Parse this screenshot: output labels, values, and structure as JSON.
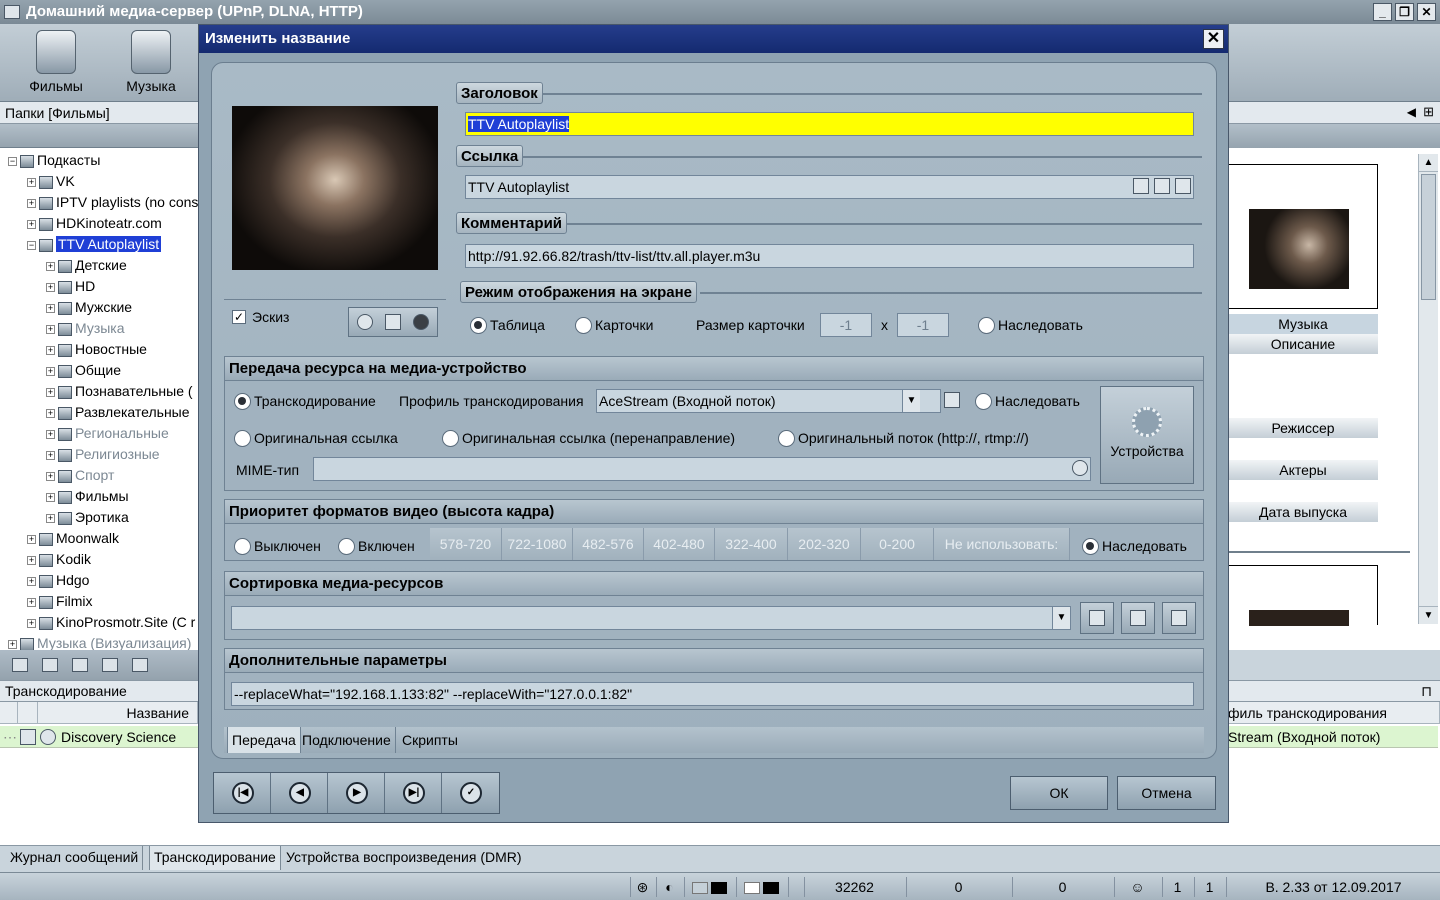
{
  "window": {
    "title": "Домашний медиа-сервер (UPnP, DLNA, HTTP)"
  },
  "toolbar": {
    "films": "Фильмы",
    "music": "Музыка"
  },
  "left": {
    "header": "Папки [Фильмы]",
    "tree": [
      {
        "label": "Подкасты",
        "level": 0
      },
      {
        "label": "VK",
        "level": 1
      },
      {
        "label": "IPTV playlists (no cons",
        "level": 1
      },
      {
        "label": "HDKinoteatr.com",
        "level": 1
      },
      {
        "label": "TTV Autoplaylist",
        "level": 1,
        "selected": true
      },
      {
        "label": "Детские",
        "level": 2
      },
      {
        "label": "HD",
        "level": 2
      },
      {
        "label": "Мужские",
        "level": 2
      },
      {
        "label": "Музыка",
        "level": 2,
        "dim": true
      },
      {
        "label": "Новостные",
        "level": 2
      },
      {
        "label": "Общие",
        "level": 2
      },
      {
        "label": "Познавательные (",
        "level": 2
      },
      {
        "label": "Развлекательные",
        "level": 2
      },
      {
        "label": "Региональные",
        "level": 2,
        "dim": true
      },
      {
        "label": "Религиозные",
        "level": 2,
        "dim": true
      },
      {
        "label": "Спорт",
        "level": 2,
        "dim": true
      },
      {
        "label": "Фильмы",
        "level": 2
      },
      {
        "label": "Эротика",
        "level": 2
      },
      {
        "label": "Moonwalk",
        "level": 1
      },
      {
        "label": "Kodik",
        "level": 1
      },
      {
        "label": "Hdgo",
        "level": 1
      },
      {
        "label": "Filmix",
        "level": 1
      },
      {
        "label": "KinoProsmotr.Site (C r",
        "level": 1
      },
      {
        "label": "Музыка (Визуализация)",
        "level": 0,
        "dim": true
      }
    ]
  },
  "transcoding": {
    "header": "Транскодирование",
    "col_name": "Название",
    "col_profile": "филь транскодирования",
    "row_name": "Discovery Science",
    "row_profile": "Stream (Входной поток)"
  },
  "right": {
    "music_label": "Музыка",
    "desc_label": "Описание",
    "director": "Режиссер",
    "actors": "Актеры",
    "release": "Дата выпуска"
  },
  "bottom_tabs": [
    "Журнал сообщений",
    "Транскодирование",
    "Устройства воспроизведения (DMR)"
  ],
  "status": {
    "count": "32262",
    "v1": "0",
    "v2": "0",
    "n1": "1",
    "n2": "1",
    "version": "В. 2.33 от 12.09.2017"
  },
  "dialog": {
    "title": "Изменить название",
    "header_label": "Заголовок",
    "header_value": "TTV Autoplaylist",
    "link_label": "Ссылка",
    "link_value": "TTV Autoplaylist",
    "comment_label": "Комментарий",
    "comment_value": "http://91.92.66.82/trash/ttv-list/ttv.all.player.m3u",
    "thumb_label": "Эскиз",
    "thumb_checked": true,
    "display_label": "Режим отображения на экране",
    "display_table": "Таблица",
    "display_cards": "Карточки",
    "card_size_label": "Размер карточки",
    "card_w": "-1",
    "card_x": "x",
    "card_h": "-1",
    "display_inherit": "Наследовать",
    "transfer_label": "Передача ресурса на медиа-устройство",
    "opt_transcode": "Транскодирование",
    "profile_label": "Профиль транскодирования",
    "profile_value": "AceStream (Входной поток)",
    "opt_inherit": "Наследовать",
    "opt_orig": "Оригинальная ссылка",
    "opt_orig_redirect": "Оригинальная ссылка (перенаправление)",
    "opt_orig_stream": "Оригинальный поток  (http://, rtmp://)",
    "mime_label": "MIME-тип",
    "devices_label": "Устройства",
    "priority_label": "Приоритет форматов видео (высота кадра)",
    "prio_off": "Выключен",
    "prio_on": "Включен",
    "formats": [
      "578-720",
      "722-1080",
      "482-576",
      "402-480",
      "322-400",
      "202-320",
      "0-200",
      "Не использовать:"
    ],
    "prio_inherit": "Наследовать",
    "sort_label": "Сортировка медиа-ресурсов",
    "extra_label": "Дополнительные параметры",
    "extra_value": "--replaceWhat=\"192.168.1.133:82\" --replaceWith=\"127.0.0.1:82\"",
    "tabs": [
      "Передача",
      "Подключение",
      "Скрипты"
    ],
    "ok": "ОК",
    "cancel": "Отмена"
  }
}
